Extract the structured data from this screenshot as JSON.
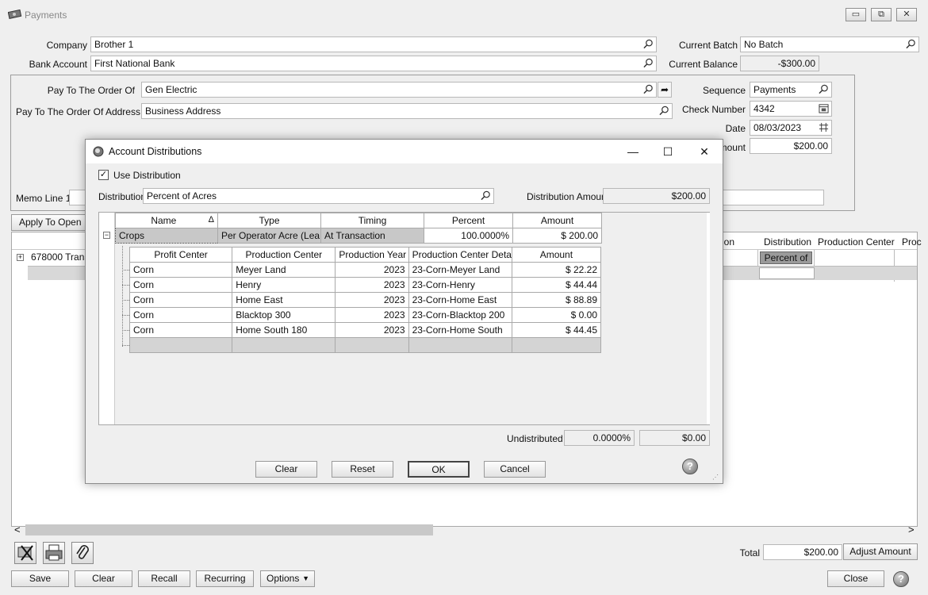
{
  "window": {
    "title": "Payments"
  },
  "header": {
    "company_label": "Company",
    "company": "Brother 1",
    "bank_account_label": "Bank Account",
    "bank_account": "First National Bank",
    "current_batch_label": "Current Batch",
    "current_batch": "No Batch",
    "current_balance_label": "Current Balance",
    "current_balance": "-$300.00"
  },
  "payee": {
    "pay_to_label": "Pay To The Order Of",
    "pay_to": "Gen Electric",
    "address_label": "Pay To The Order Of Address",
    "address": "Business Address",
    "sequence_label": "Sequence",
    "sequence": "Payments",
    "check_number_label": "Check Number",
    "check_number": "4342",
    "date_label": "Date",
    "date": "08/03/2023",
    "amount_label_partial": "mount",
    "amount": "$200.00",
    "memo_label": "Memo Line 1"
  },
  "grid": {
    "apply_button_partial": "Apply To Open In",
    "row_partial": "678000 Trans",
    "col_partial_1": "ion",
    "col_distribution": "Distribution",
    "col_production_center": "Production Center",
    "col_partial_2": "Proc",
    "distribution_value_partial": "Percent of"
  },
  "dialog": {
    "title": "Account Distributions",
    "use_distribution_label": "Use Distribution",
    "distribution_label": "Distribution",
    "distribution": "Percent of Acres",
    "distribution_amount_label": "Distribution Amount",
    "distribution_amount": "$200.00",
    "parent_headers": {
      "name": "Name",
      "sort_icon": "Δ",
      "type": "Type",
      "timing": "Timing",
      "percent": "Percent",
      "amount": "Amount"
    },
    "parent_row": {
      "name": "Crops",
      "type": "Per Operator Acre (Lea",
      "timing": "At Transaction",
      "percent": "100.0000%",
      "amount": "$ 200.00"
    },
    "child_headers": {
      "profit_center": "Profit Center",
      "production_center": "Production Center",
      "production_year": "Production Year",
      "detail": "Production Center Detail",
      "amount": "Amount"
    },
    "child_rows": [
      {
        "profit_center": "Corn",
        "production_center": "Meyer Land",
        "year": "2023",
        "detail": "23-Corn-Meyer Land",
        "amount": "$ 22.22"
      },
      {
        "profit_center": "Corn",
        "production_center": "Henry",
        "year": "2023",
        "detail": "23-Corn-Henry",
        "amount": "$ 44.44"
      },
      {
        "profit_center": "Corn",
        "production_center": "Home East",
        "year": "2023",
        "detail": "23-Corn-Home East",
        "amount": "$ 88.89"
      },
      {
        "profit_center": "Corn",
        "production_center": "Blacktop 300",
        "year": "2023",
        "detail": "23-Corn-Blacktop 200",
        "amount": "$ 0.00"
      },
      {
        "profit_center": "Corn",
        "production_center": "Home South 180",
        "year": "2023",
        "detail": "23-Corn-Home South",
        "amount": "$ 44.45"
      }
    ],
    "undistributed_label": "Undistributed",
    "undistributed_percent": "0.0000%",
    "undistributed_amount": "$0.00",
    "buttons": {
      "clear": "Clear",
      "reset": "Reset",
      "ok": "OK",
      "cancel": "Cancel"
    },
    "help": "?"
  },
  "footer": {
    "total_label": "Total",
    "total": "$200.00",
    "adjust_amount": "Adjust Amount",
    "save": "Save",
    "clear": "Clear",
    "recall": "Recall",
    "recurring": "Recurring",
    "options": "Options",
    "close": "Close",
    "help": "?"
  },
  "scroll": {
    "left": "<",
    "right": ">"
  },
  "icons": [
    "money-icon",
    "search-icon",
    "goto-icon",
    "calendar-icon",
    "date-picker-icon",
    "void-check-icon",
    "print-icon",
    "attachment-icon",
    "help-icon",
    "expand-icon",
    "collapse-icon",
    "checkbox-checked-icon",
    "dropdown-arrow-icon"
  ]
}
